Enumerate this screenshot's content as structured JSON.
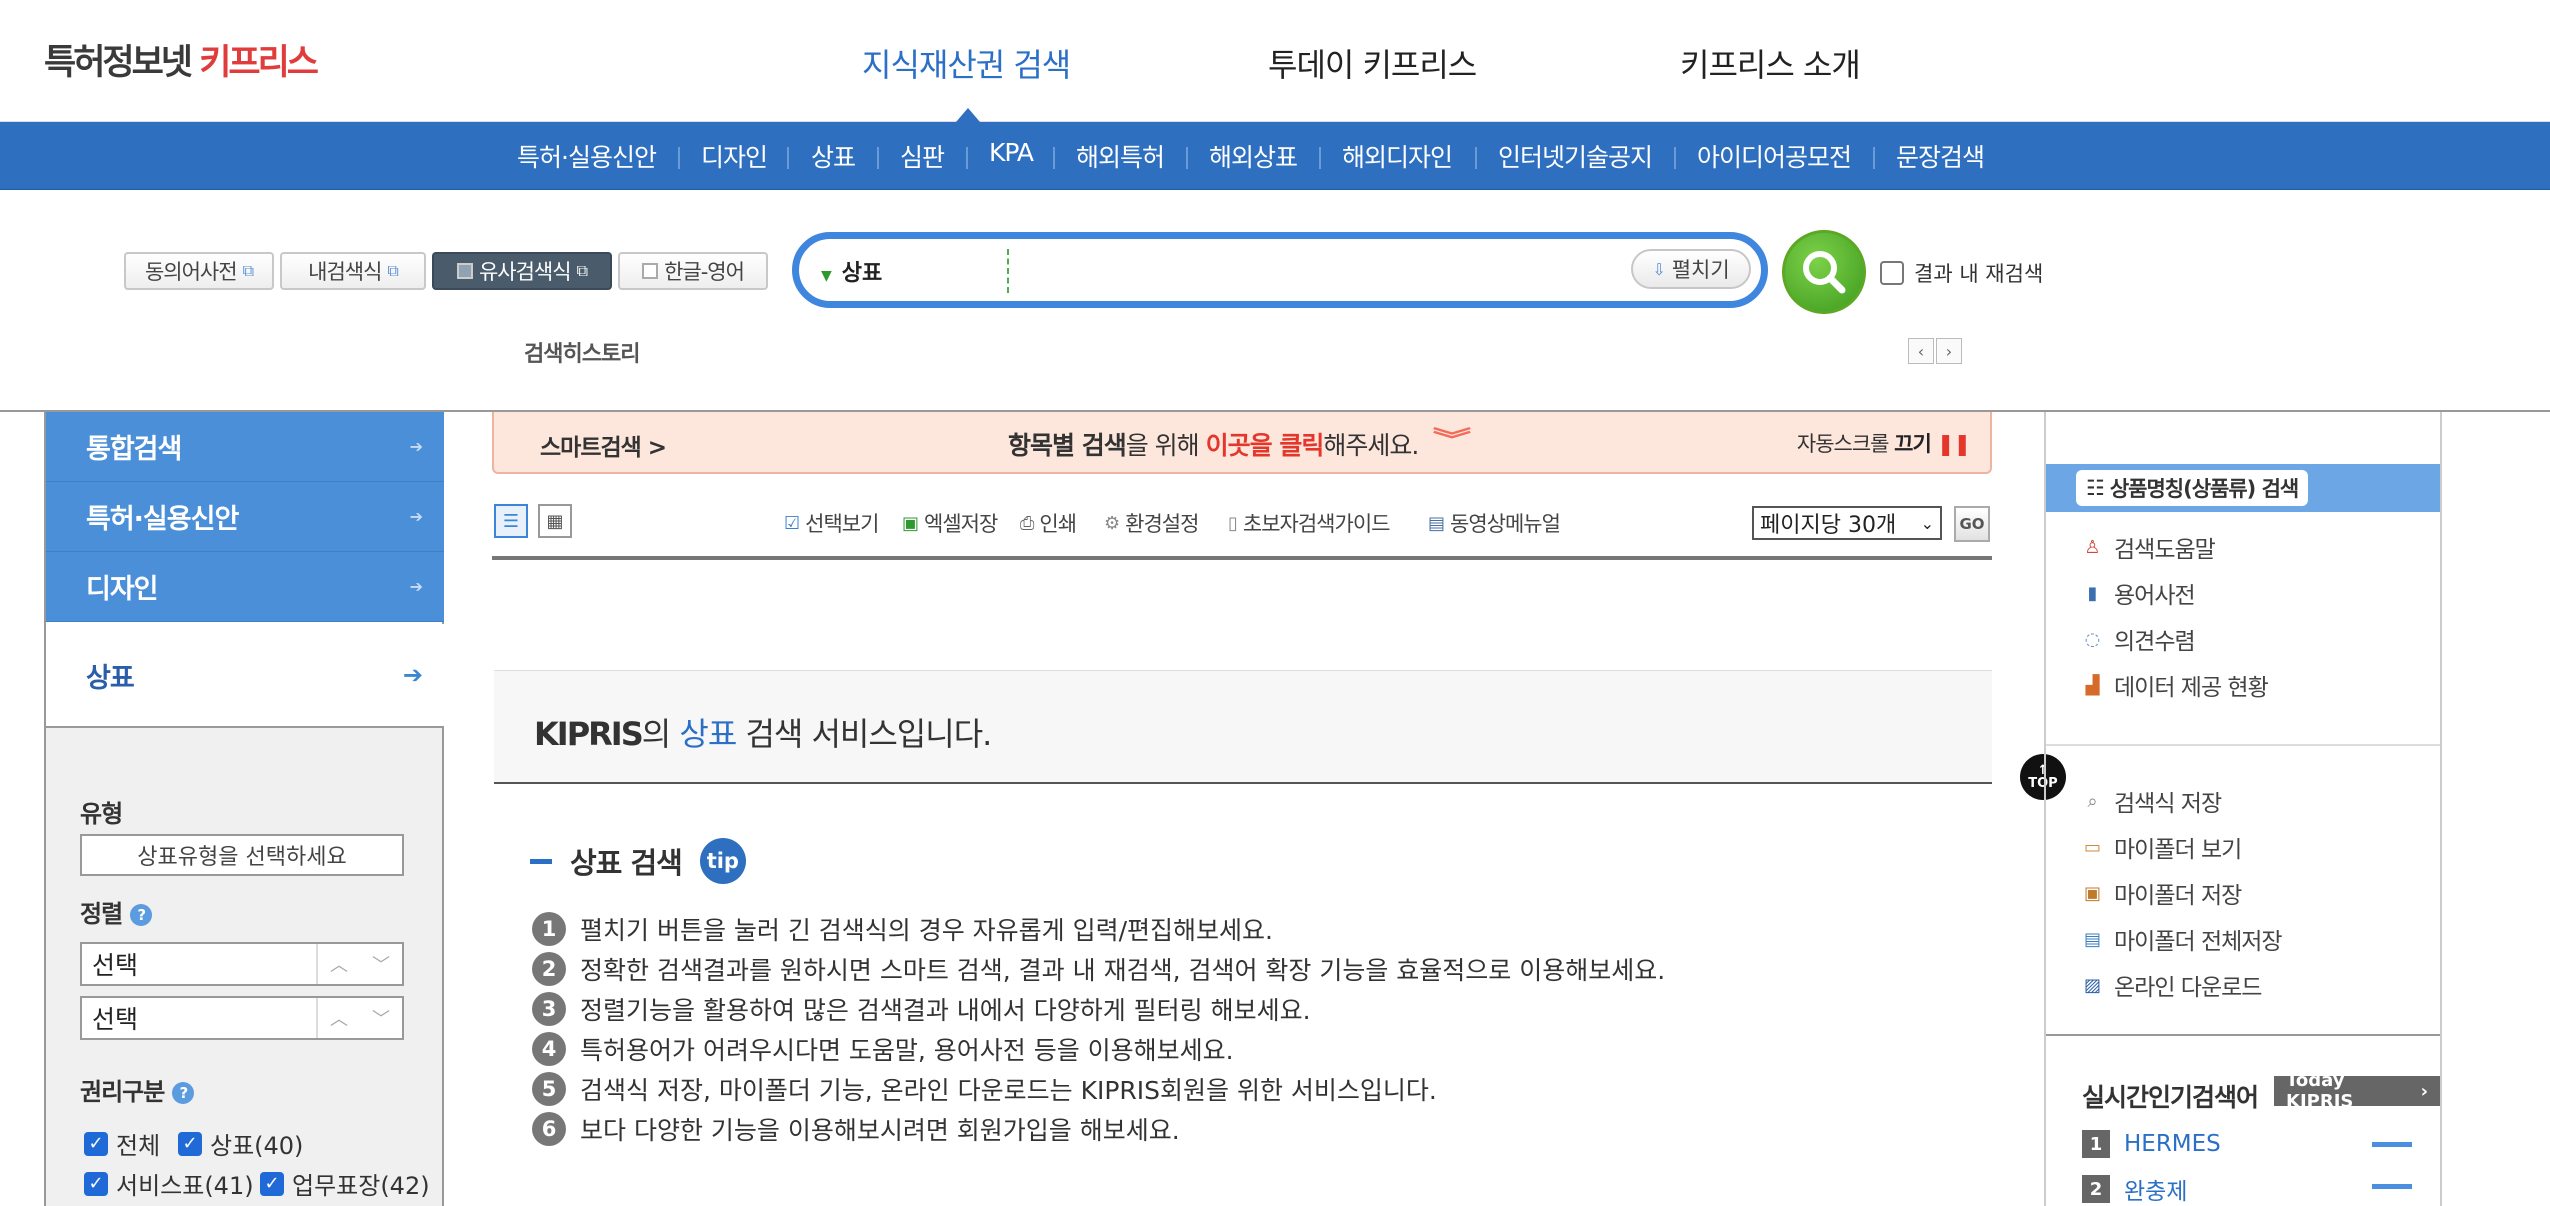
{
  "header": {
    "logo_main": "특허정보넷 ",
    "logo_accent": "키프리스",
    "nav": [
      "지식재산권 검색",
      "투데이 키프리스",
      "키프리스 소개"
    ]
  },
  "subnav": [
    "특허·실용신안",
    "디자인",
    "상표",
    "심판",
    "KPA",
    "해외특허",
    "해외상표",
    "해외디자인",
    "인터넷기술공지",
    "아이디어공모전",
    "문장검색"
  ],
  "search": {
    "chips": [
      "동의어사전",
      "내검색식",
      "유사검색식",
      "한글-영어"
    ],
    "category": "상표",
    "query": "",
    "expand_label": "펼치기",
    "within_label": "결과 내 재검색",
    "history_label": "검색히스토리"
  },
  "leftnav": {
    "items": [
      "통합검색",
      "특허·실용신안",
      "디자인",
      "상표"
    ],
    "type_label": "유형",
    "type_placeholder": "상표유형을 선택하세요",
    "sort_label": "정렬",
    "sort_values": [
      "선택",
      "선택"
    ],
    "rights_label": "권리구분",
    "rights": [
      "전체",
      "상표(40)",
      "서비스표(41)",
      "업무표장(42)"
    ]
  },
  "banner": {
    "left": "스마트검색 >",
    "c1": "항목별 검색",
    "c2": "을 위해 ",
    "c3": "이곳을 클릭",
    "c4": "해주세요.",
    "right1": "자동스크롤 ",
    "right2": "끄기"
  },
  "toolbar": {
    "tools": [
      "선택보기",
      "엑셀저장",
      "인쇄",
      "환경설정",
      "초보자검색가이드",
      "동영상메뉴얼"
    ],
    "perpage": "페이지당 30개",
    "go": "GO"
  },
  "info": {
    "brand": "KIPRIS",
    "mid": "의 ",
    "service": "상표",
    "tail": " 검색 서비스입니다."
  },
  "tips": {
    "title": "상표 검색",
    "badge": "tip",
    "lines": [
      "펼치기 버튼을 눌러 긴 검색식의 경우 자유롭게 입력/편집해보세요.",
      "정확한 검색결과를 원하시면 스마트 검색, 결과 내 재검색, 검색어 확장 기능을 효율적으로 이용해보세요.",
      "정렬기능을 활용하여 많은 검색결과 내에서 다양하게 필터링 해보세요.",
      "특허용어가 어려우시다면 도움말, 용어사전 등을 이용해보세요.",
      "검색식 저장, 마이폴더 기능, 온라인 다운로드는 KIPRIS회원을 위한 서비스입니다.",
      "보다 다양한 기능을 이용해보시려면 회원가입을 해보세요."
    ]
  },
  "top_label": "TOP",
  "rightnav": {
    "highlight": "상품명칭(상품류) 검색",
    "links1": [
      "검색도움말",
      "용어사전",
      "의견수렴",
      "데이터 제공 현황"
    ],
    "links2": [
      "검색식 저장",
      "마이폴더 보기",
      "마이폴더 저장",
      "마이폴더 전체저장",
      "온라인 다운로드"
    ],
    "popular_title": "실시간인기검색어",
    "today_badge": "Today KIPRIS",
    "popular": [
      "HERMES",
      "완충제"
    ]
  },
  "colors": {
    "primary": "#2e6fbf",
    "accent_red": "#e03c3c",
    "search_green": "#3d9a1c",
    "highlight_blue": "#6ca6e4"
  }
}
